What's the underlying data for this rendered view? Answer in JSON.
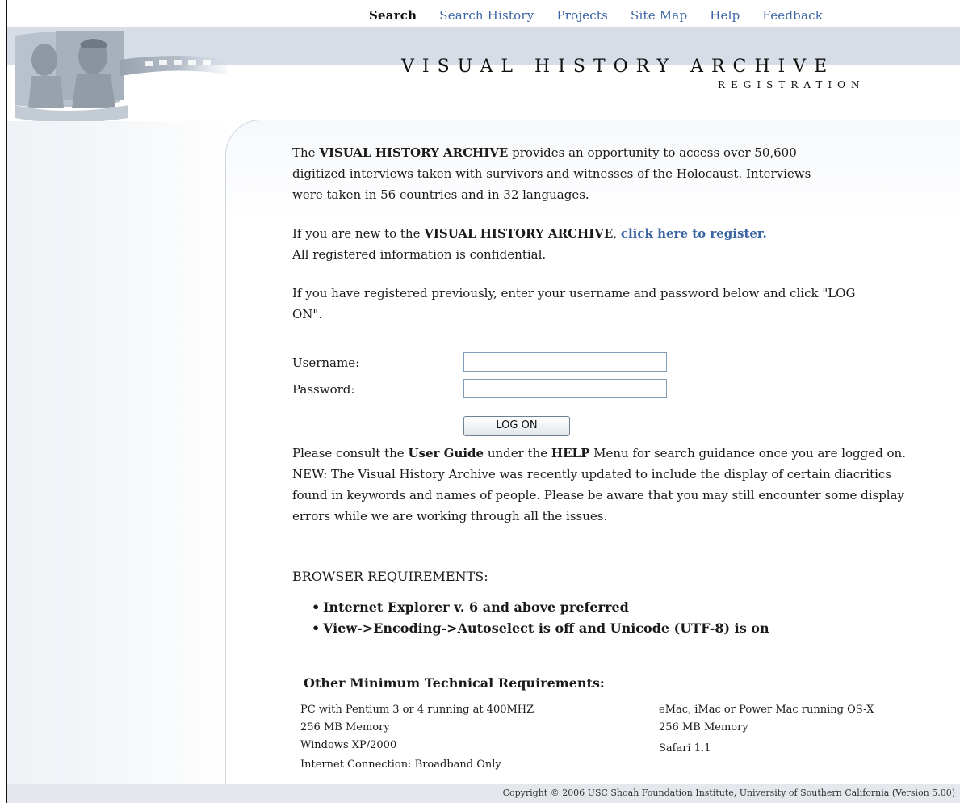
{
  "nav": {
    "items": [
      "Search",
      "Search History",
      "Projects",
      "Site Map",
      "Help",
      "Feedback"
    ]
  },
  "header": {
    "title": "VISUAL HISTORY ARCHIVE",
    "subtitle": "REGISTRATION"
  },
  "intro": {
    "p1_a": "The ",
    "p1_b": "VISUAL HISTORY ARCHIVE",
    "p1_c": " provides an opportunity to access over 50,600 digitized interviews taken with survivors and witnesses of the Holocaust. Interviews were taken in 56 countries and in 32 languages.",
    "p2_a": "If you are new to the ",
    "p2_b": "VISUAL HISTORY ARCHIVE",
    "p2_c": ", ",
    "register_link": "click here to register.",
    "p2_d": "All registered information is confidential.",
    "p3": "If you have registered previously, enter your username and password below and click \"LOG ON\"."
  },
  "form": {
    "username_label": "Username:",
    "password_label": "Password:",
    "username_value": "",
    "password_value": "",
    "logon_button": "LOG ON"
  },
  "guide": {
    "a": "Please consult the ",
    "b": "User Guide",
    "c": " under the ",
    "d": "HELP",
    "e": " Menu for search guidance once you are logged on.",
    "new_note": "NEW: The Visual History Archive was recently updated to include the display of certain diacritics found in keywords and names of people. Please be aware that you may still encounter some display errors while we are working through all the issues."
  },
  "browser": {
    "heading": "BROWSER REQUIREMENTS:",
    "items": [
      "Internet Explorer v. 6 and above preferred",
      "View->Encoding->Autoselect is off and Unicode (UTF-8) is on"
    ]
  },
  "tech": {
    "heading": "Other Minimum Technical Requirements:",
    "pc": [
      "PC with Pentium 3 or 4 running at 400MHZ",
      "256 MB Memory",
      "Windows XP/2000",
      "Internet Connection: Broadband Only"
    ],
    "mac": [
      "eMac, iMac or Power Mac running OS-X",
      "256 MB Memory",
      "Safari 1.1"
    ]
  },
  "footer": {
    "copyright": "Copyright © 2006 USC Shoah Foundation Institute, University of Southern California (Version 5.00)"
  },
  "colors": {
    "link": "#3a64a2",
    "band": "#d6dde6"
  }
}
